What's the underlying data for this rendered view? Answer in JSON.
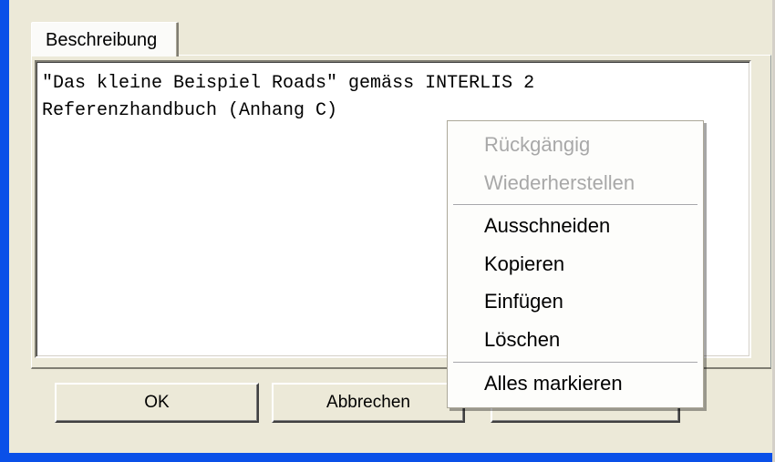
{
  "tabs": [
    {
      "label": "Beschreibung",
      "selected": true
    }
  ],
  "description": {
    "lines": [
      "\"Das kleine Beispiel Roads\" gemäss INTERLIS 2",
      "Referenzhandbuch (Anhang C)"
    ]
  },
  "buttons": {
    "ok_label": "OK",
    "cancel_label": "Abbrechen",
    "third_label": ""
  },
  "context_menu": {
    "items": [
      {
        "label": "Rückgängig",
        "enabled": false
      },
      {
        "label": "Wiederherstellen",
        "enabled": false
      },
      {
        "label": "Ausschneiden",
        "enabled": true
      },
      {
        "label": "Kopieren",
        "enabled": true
      },
      {
        "label": "Einfügen",
        "enabled": true
      },
      {
        "label": "Löschen",
        "enabled": true
      },
      {
        "label": "Alles markieren",
        "enabled": true
      }
    ]
  },
  "colors": {
    "window_frame": "#0a50e8",
    "dialog_background": "#ece9d8",
    "disabled_text": "#a8a8a8"
  }
}
